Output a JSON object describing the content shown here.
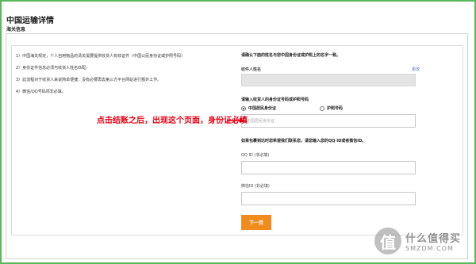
{
  "header": {
    "title": "中国运输详情",
    "subtitle": "海关信息"
  },
  "notes": [
    "1）中国海关规定，个人自用物品的清关需要提供收货人有效证件（中国公民身份证或护照号码）",
    "2）身份证件信息必须与收货人姓名匹配。",
    "3）此流程对于收货人来说简单便捷：没有必要再去第三方平台网站进行额外工作。",
    "4）微信/QQ号码项非必填。"
  ],
  "form": {
    "instruction": "请确认下面的姓名与您中国身份证或护照上的名字一致。",
    "name_label": "收件人姓名",
    "change_link": "更改",
    "name_value": "",
    "id_prompt": "请输入收货人的身份证号码或护照号码",
    "radio_id_card": "中国居民身份证",
    "radio_passport": "护照号码",
    "id_placeholder": "中国居民身份证",
    "contact_note": "如果包裹到达时您希望我们联系您，请您输入您的QQ ID或者微信ID。",
    "qq_label": "QQ ID (非必填)",
    "wechat_label": "微信ID (非必填)",
    "next_button": "下一页"
  },
  "annotation": {
    "text": "点击结账之后，出现这个页面，身份证必填",
    "color": "#e60012"
  },
  "watermark": {
    "logo_glyph": "值",
    "text_cn": "什么值得买",
    "text_en": "SMZDM.COM"
  },
  "colors": {
    "frame": "#58b85a",
    "button": "#f08c1e",
    "annotation": "#e60012"
  }
}
